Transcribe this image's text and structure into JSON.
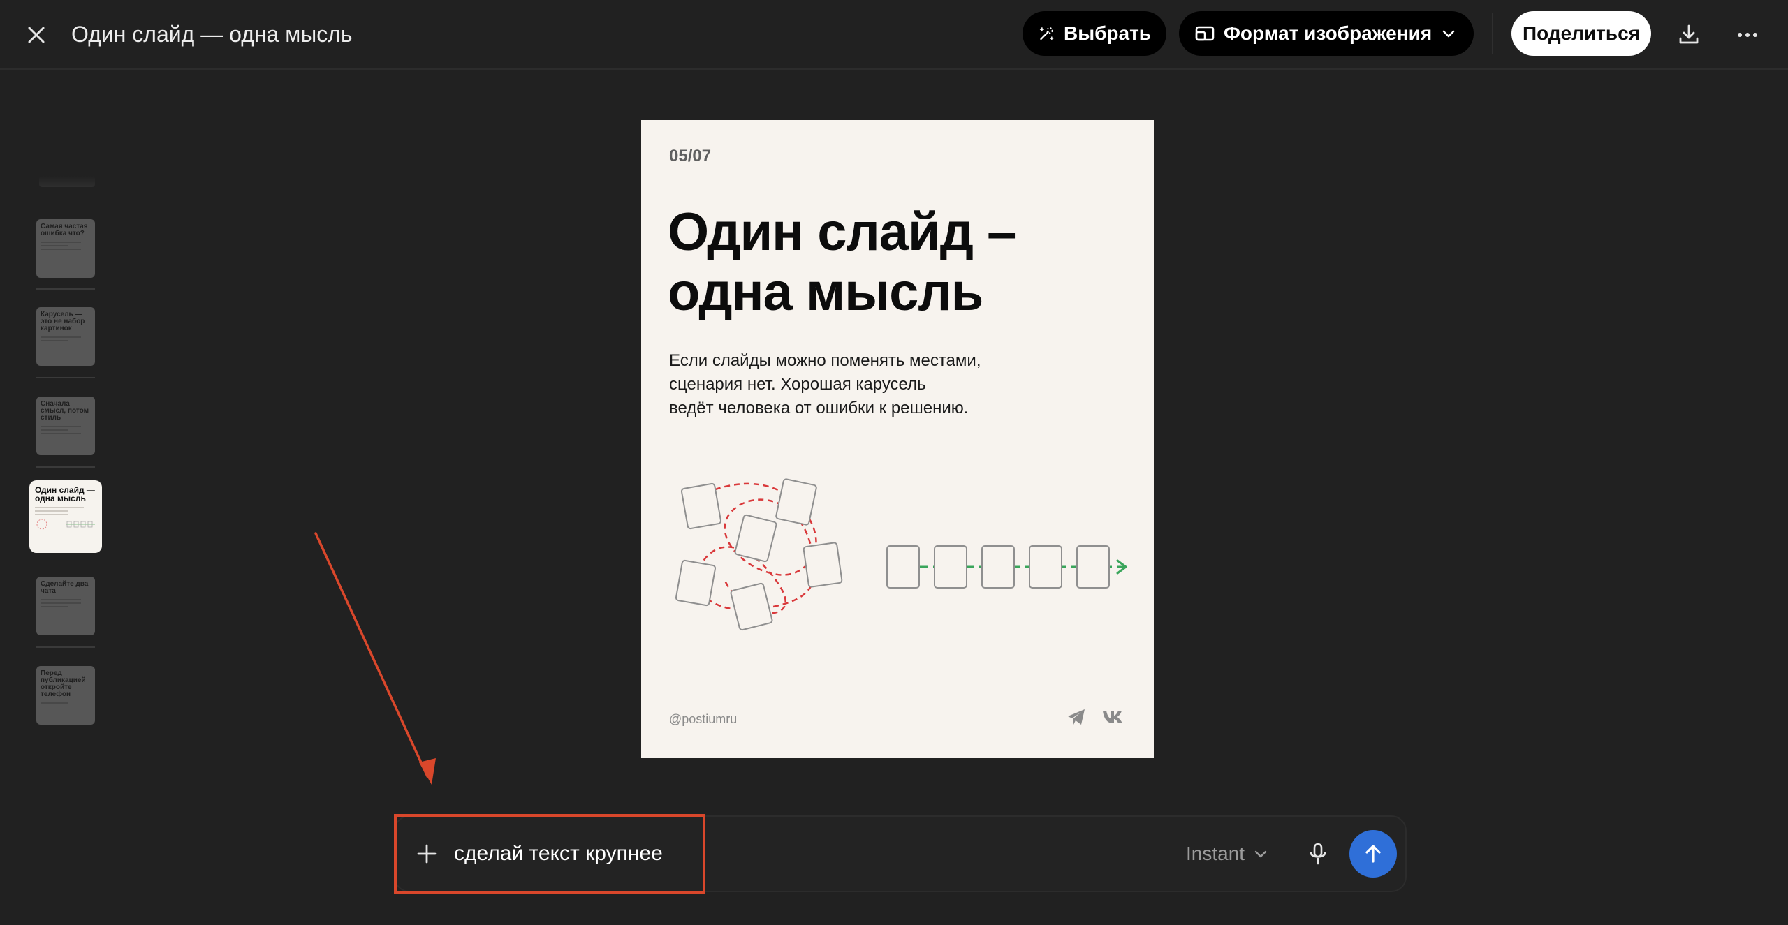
{
  "header": {
    "title": "Один слайд — одна мысль",
    "select_label": "Выбрать",
    "format_label": "Формат изображения",
    "share_label": "Поделиться"
  },
  "thumbnails": [
    {
      "label": "Самая частая ошибка что?",
      "active": false
    },
    {
      "label": "Карусель — это не набор картинок",
      "active": false
    },
    {
      "label": "Сначала смысл, потом стиль",
      "active": false
    },
    {
      "label": "Один слайд — одна мысль",
      "active": true
    },
    {
      "label": "Сделайте два чата",
      "active": false
    },
    {
      "label": "Перед публикацией откройте телефон",
      "active": false
    }
  ],
  "slide": {
    "counter": "05/07",
    "title_line1": "Один слайд –",
    "title_line2": "одна мысль",
    "body_line1": "Если слайды можно поменять местами,",
    "body_line2": "сценария нет. Хорошая карусель",
    "body_line3": "ведёт человека от ошибки к решению.",
    "handle": "@postiumru",
    "social_icons": [
      "telegram-icon",
      "vk-icon"
    ],
    "colors": {
      "background": "#f7f3ee",
      "chaos_path": "#d9383a",
      "order_path": "#3aa55b"
    }
  },
  "composer": {
    "input_value": "сделай текст крупнее",
    "model": "Instant"
  },
  "colors": {
    "app_background": "#212121",
    "annotation": "#d9472b",
    "send_button": "#2f6fd8"
  }
}
